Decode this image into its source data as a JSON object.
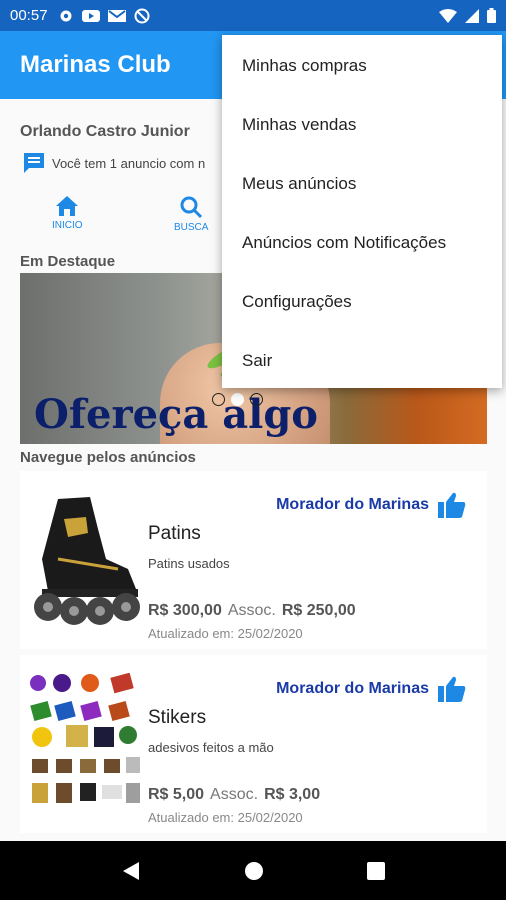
{
  "status_bar": {
    "time": "00:57"
  },
  "app": {
    "title": "Marinas Club"
  },
  "user": {
    "name": "Orlando Castro Junior"
  },
  "notice": {
    "text": "Você tem 1 anuncio com n"
  },
  "nav": {
    "home_label": "INICIO",
    "search_label": "BUSCA"
  },
  "sections": {
    "featured": "Em Destaque",
    "browse": "Navegue pelos anúncios"
  },
  "banner": {
    "caption": "Ofereça algo",
    "slides": 3,
    "active_slide": 1
  },
  "listings": [
    {
      "badge": "Morador do Marinas",
      "name": "Patins",
      "description": "Patins usados",
      "price": "R$ 300,00",
      "assoc_label": "Assoc.",
      "assoc_price": "R$ 250,00",
      "updated": "Atualizado em: 25/02/2020"
    },
    {
      "badge": "Morador do Marinas",
      "name": "Stikers",
      "description": "adesivos feitos a mão",
      "price": "R$ 5,00",
      "assoc_label": "Assoc.",
      "assoc_price": "R$ 3,00",
      "updated": "Atualizado em: 25/02/2020"
    }
  ],
  "menu": {
    "items": [
      "Minhas compras",
      "Minhas vendas",
      "Meus anúncios",
      "Anúncios com Notificações",
      "Configurações",
      "Sair"
    ]
  },
  "colors": {
    "primary": "#2196f3",
    "status_bar": "#1565c0",
    "badge_text": "#1a3aa8"
  }
}
